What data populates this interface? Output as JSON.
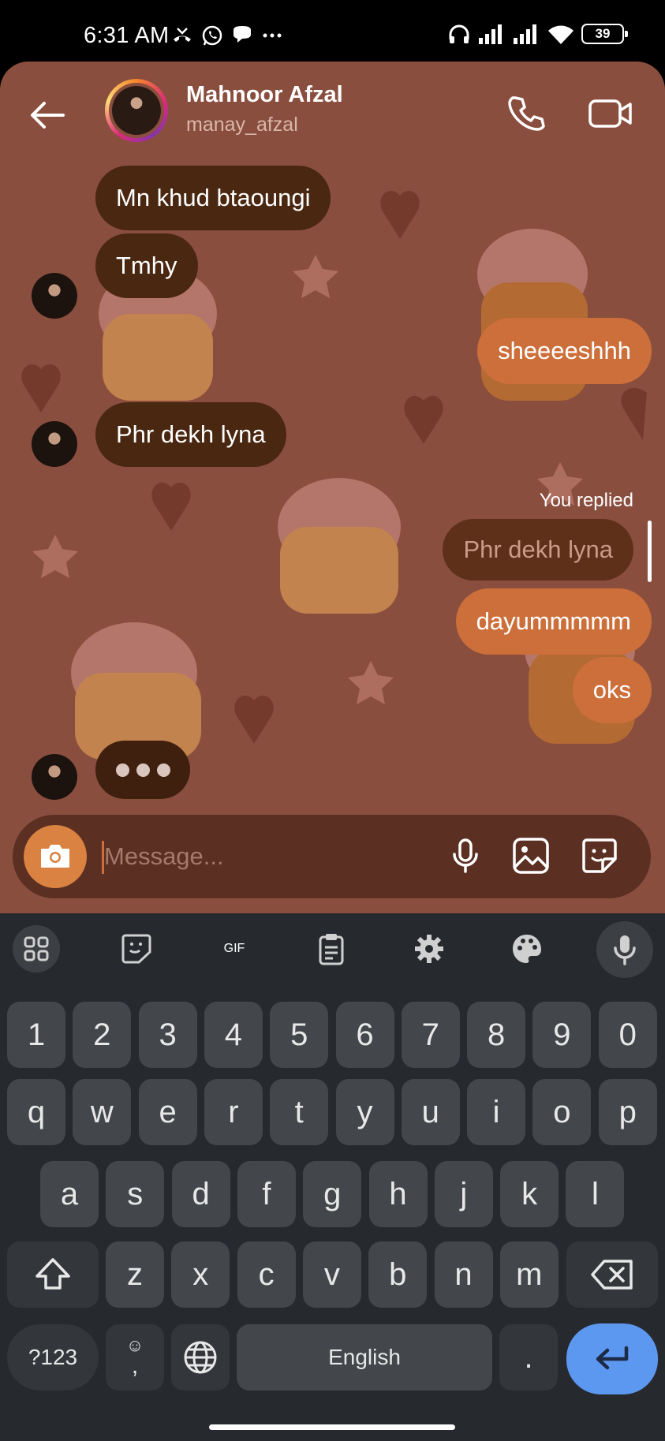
{
  "status_bar": {
    "time": "6:31 AM",
    "battery": "39"
  },
  "header": {
    "name": "Mahnoor Afzal",
    "handle": "manay_afzal"
  },
  "messages": [
    {
      "text": "Mn khud btaoungi",
      "from": "them"
    },
    {
      "text": "Tmhy",
      "from": "them"
    },
    {
      "text": "sheeeeshhh",
      "from": "me"
    },
    {
      "text": "Phr dekh lyna",
      "from": "them"
    },
    {
      "text": "dayummmmm",
      "from": "me"
    },
    {
      "text": "oks",
      "from": "me"
    }
  ],
  "reply": {
    "label": "You replied",
    "quoted": "Phr dekh lyna"
  },
  "composer": {
    "placeholder": "Message..."
  },
  "keyboard": {
    "toolbar": [
      "apps-icon",
      "sticker-icon",
      "GIF",
      "clipboard-icon",
      "settings-icon",
      "palette-icon",
      "mic-icon"
    ],
    "row_numbers": [
      "1",
      "2",
      "3",
      "4",
      "5",
      "6",
      "7",
      "8",
      "9",
      "0"
    ],
    "row1": [
      "q",
      "w",
      "e",
      "r",
      "t",
      "y",
      "u",
      "i",
      "o",
      "p"
    ],
    "row2": [
      "a",
      "s",
      "d",
      "f",
      "g",
      "h",
      "j",
      "k",
      "l"
    ],
    "row3": [
      "z",
      "x",
      "c",
      "v",
      "b",
      "n",
      "m"
    ],
    "symbols_key": "?123",
    "comma_key": ",",
    "space_key": "English",
    "period_key": "."
  },
  "colors": {
    "chat_bg": "#8a4e3e",
    "incoming": "#4a2710",
    "outgoing": "#cd6f3a",
    "keyboard_bg": "#262a2f",
    "enter": "#5d98f0"
  }
}
